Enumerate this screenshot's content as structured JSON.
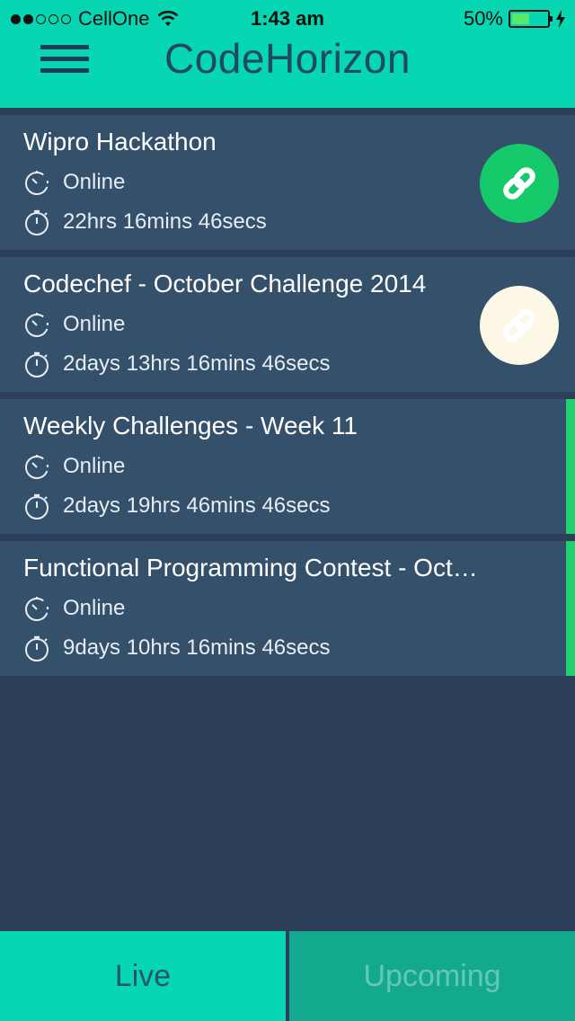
{
  "status_bar": {
    "carrier": "CellOne",
    "time": "1:43 am",
    "battery": "50%",
    "battery_level": 0.5,
    "signal_bars_filled": 2,
    "signal_bars_total": 5
  },
  "header": {
    "title": "CodeHorizon",
    "menu_icon": "hamburger-menu-icon"
  },
  "contests": [
    {
      "title": "Wipro Hackathon",
      "location": "Online",
      "time_left": "22hrs 16mins 46secs",
      "link_button": "green",
      "accent": false
    },
    {
      "title": "Codechef - October Challenge 2014",
      "location": "Online",
      "time_left": "2days 13hrs 16mins 46secs",
      "link_button": "cream",
      "accent": false
    },
    {
      "title": "Weekly Challenges - Week 11",
      "location": "Online",
      "time_left": "2days 19hrs 46mins 46secs",
      "link_button": null,
      "accent": true
    },
    {
      "title": "Functional Programming Contest - Oct…",
      "location": "Online",
      "time_left": "9days 10hrs 16mins 46secs",
      "link_button": null,
      "accent": true
    }
  ],
  "tabs": {
    "live": "Live",
    "upcoming": "Upcoming",
    "active": "live"
  },
  "colors": {
    "header": "#06d6b1",
    "background": "#2b3f58",
    "card": "#34506b",
    "accent_green": "#1fd16f",
    "link_green": "#16c96b",
    "link_cream": "#fdf8e6",
    "tab_inactive": "#13a98f"
  }
}
